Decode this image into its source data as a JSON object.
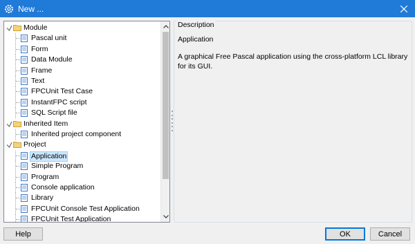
{
  "window": {
    "title": "New ...",
    "close_label": "Close"
  },
  "tree": {
    "rows": [
      {
        "label": "Module",
        "kind": "folder",
        "level": 0,
        "expanded": true
      },
      {
        "label": "Pascal unit",
        "kind": "item",
        "level": 1
      },
      {
        "label": "Form",
        "kind": "item",
        "level": 1
      },
      {
        "label": "Data Module",
        "kind": "item",
        "level": 1
      },
      {
        "label": "Frame",
        "kind": "item",
        "level": 1
      },
      {
        "label": "Text",
        "kind": "item",
        "level": 1
      },
      {
        "label": "FPCUnit Test Case",
        "kind": "item",
        "level": 1
      },
      {
        "label": "InstantFPC script",
        "kind": "item",
        "level": 1
      },
      {
        "label": "SQL Script file",
        "kind": "item",
        "level": 1
      },
      {
        "label": "Inherited Item",
        "kind": "folder",
        "level": 0,
        "expanded": true
      },
      {
        "label": "Inherited project component",
        "kind": "item",
        "level": 1
      },
      {
        "label": "Project",
        "kind": "folder",
        "level": 0,
        "expanded": true
      },
      {
        "label": "Application",
        "kind": "item",
        "level": 1,
        "selected": true
      },
      {
        "label": "Simple Program",
        "kind": "item",
        "level": 1
      },
      {
        "label": "Program",
        "kind": "item",
        "level": 1
      },
      {
        "label": "Console application",
        "kind": "item",
        "level": 1
      },
      {
        "label": "Library",
        "kind": "item",
        "level": 1
      },
      {
        "label": "FPCUnit Console Test Application",
        "kind": "item",
        "level": 1
      },
      {
        "label": "FPCUnit Test Application",
        "kind": "item",
        "level": 1
      }
    ]
  },
  "description": {
    "group_label": "Description",
    "heading": "Application",
    "text": "A graphical Free Pascal application using the cross-platform LCL library for its GUI."
  },
  "buttons": {
    "help": "Help",
    "ok": "OK",
    "cancel": "Cancel"
  },
  "colors": {
    "titlebar": "#1f7ad8",
    "folder": "#e8c468",
    "doc_border": "#3c78c8",
    "selection": "#cce8ff"
  }
}
